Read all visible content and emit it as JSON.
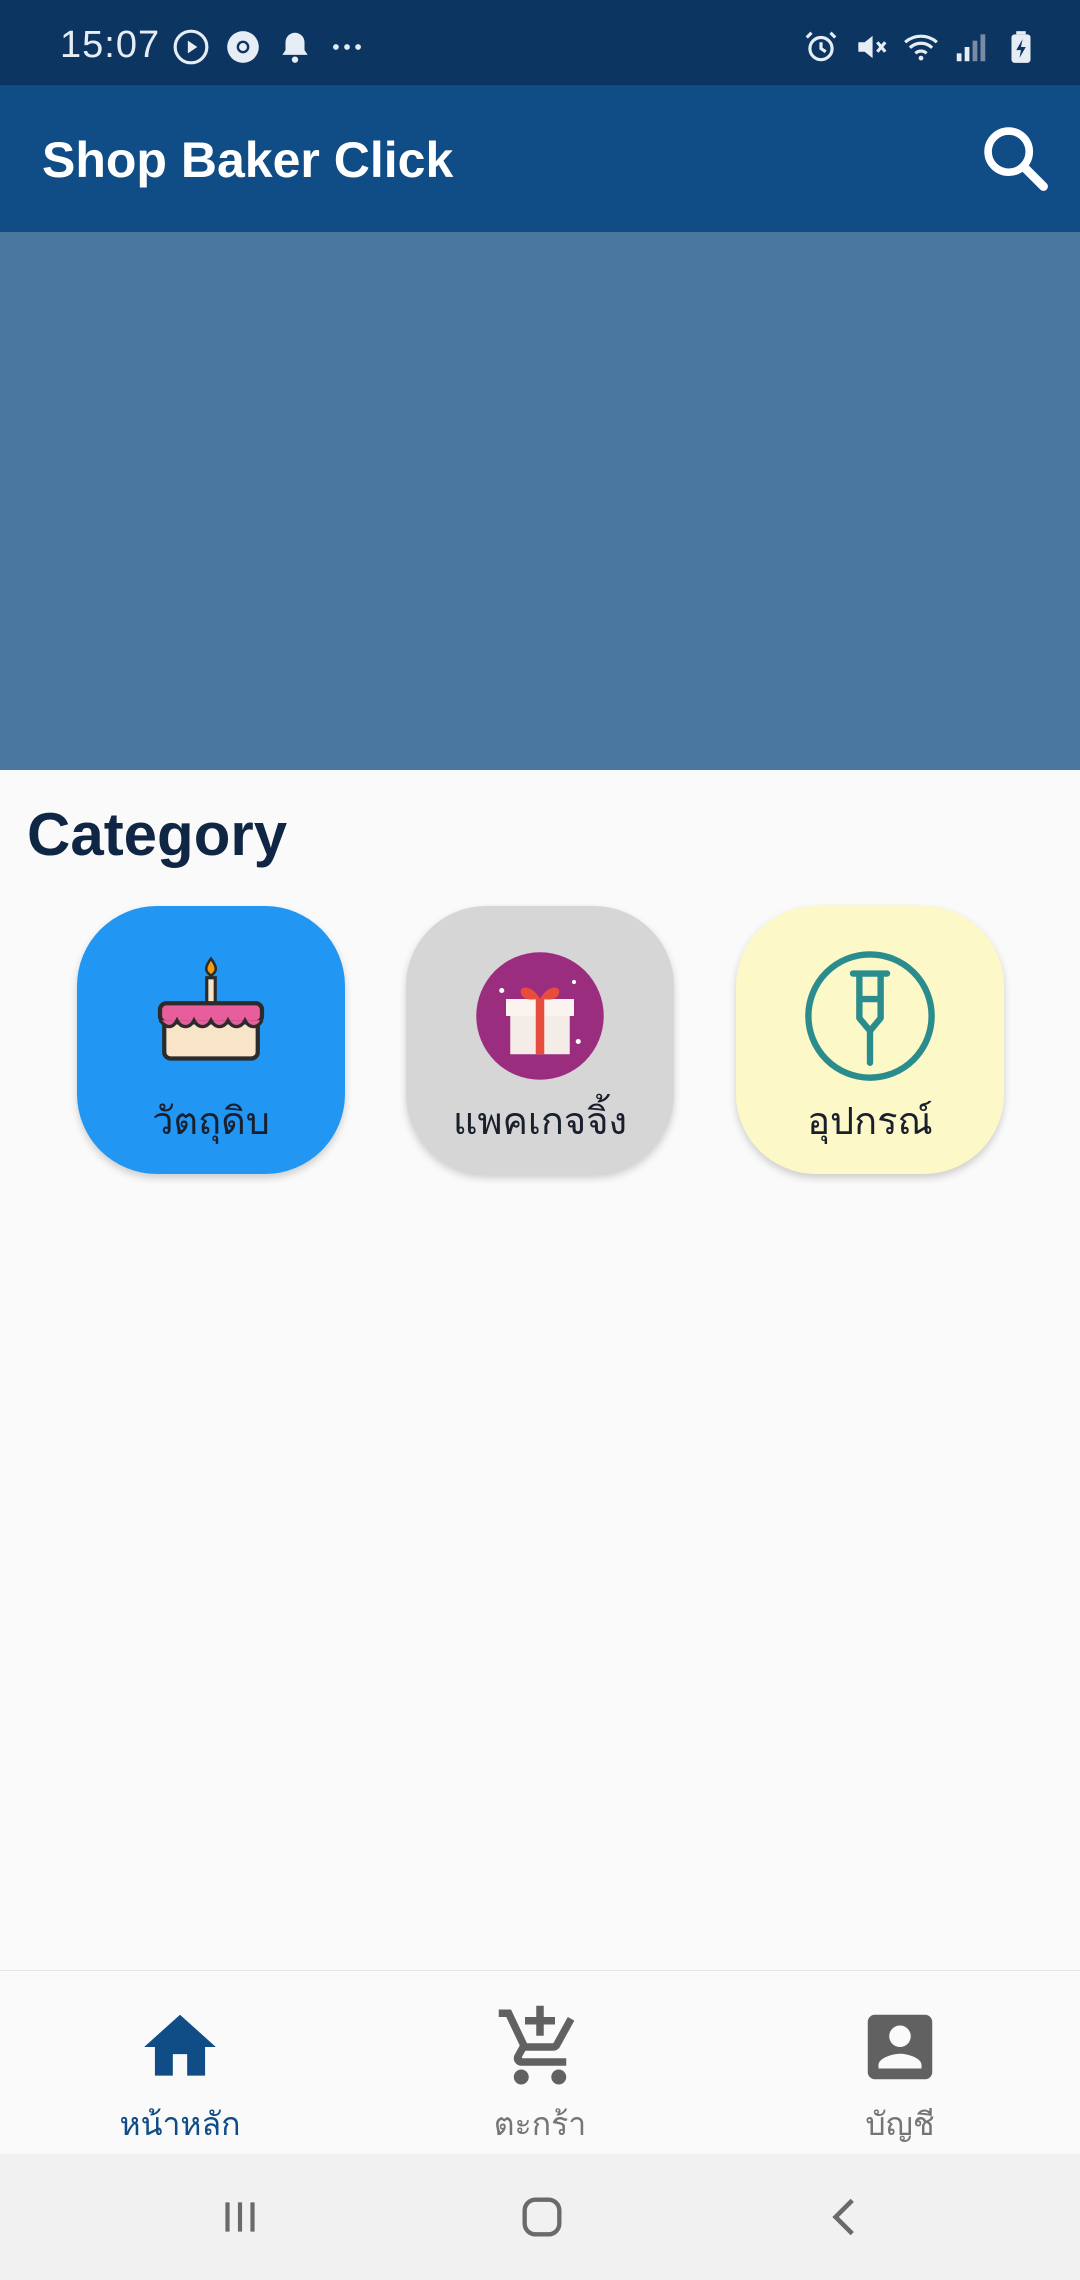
{
  "status_bar": {
    "time": "15:07",
    "left_icons": [
      "play-icon",
      "chrome-icon",
      "bell-icon",
      "more-dots-icon"
    ],
    "right_icons": [
      "alarm-icon",
      "mute-icon",
      "wifi-icon",
      "signal-icon",
      "battery-charging-icon"
    ]
  },
  "app_bar": {
    "title": "Shop Baker Click",
    "search_icon": "search-icon"
  },
  "banner": {
    "color": "#4a779e"
  },
  "category": {
    "title": "Category",
    "items": [
      {
        "label": "วัตถุดิบ",
        "icon": "cake-icon",
        "color": "#2196f3"
      },
      {
        "label": "แพคเกจจิ้ง",
        "icon": "gift-icon",
        "color": "#d6d6d6"
      },
      {
        "label": "อุปกรณ์",
        "icon": "crutch-icon",
        "color": "#fdf8c8"
      }
    ]
  },
  "bottom_nav": {
    "items": [
      {
        "label": "หน้าหลัก",
        "icon": "home-icon",
        "active": true
      },
      {
        "label": "ตะกร้า",
        "icon": "add-cart-icon",
        "active": false
      },
      {
        "label": "บัญชี",
        "icon": "account-box-icon",
        "active": false
      }
    ],
    "active_color": "#104c85",
    "inactive_color": "#757575"
  },
  "system_nav": {
    "buttons": [
      "recent-apps-icon",
      "home-circle-icon",
      "back-icon"
    ]
  },
  "colors": {
    "status_bar": "#0d3561",
    "app_bar": "#104c85",
    "title_text": "#0f2744"
  }
}
